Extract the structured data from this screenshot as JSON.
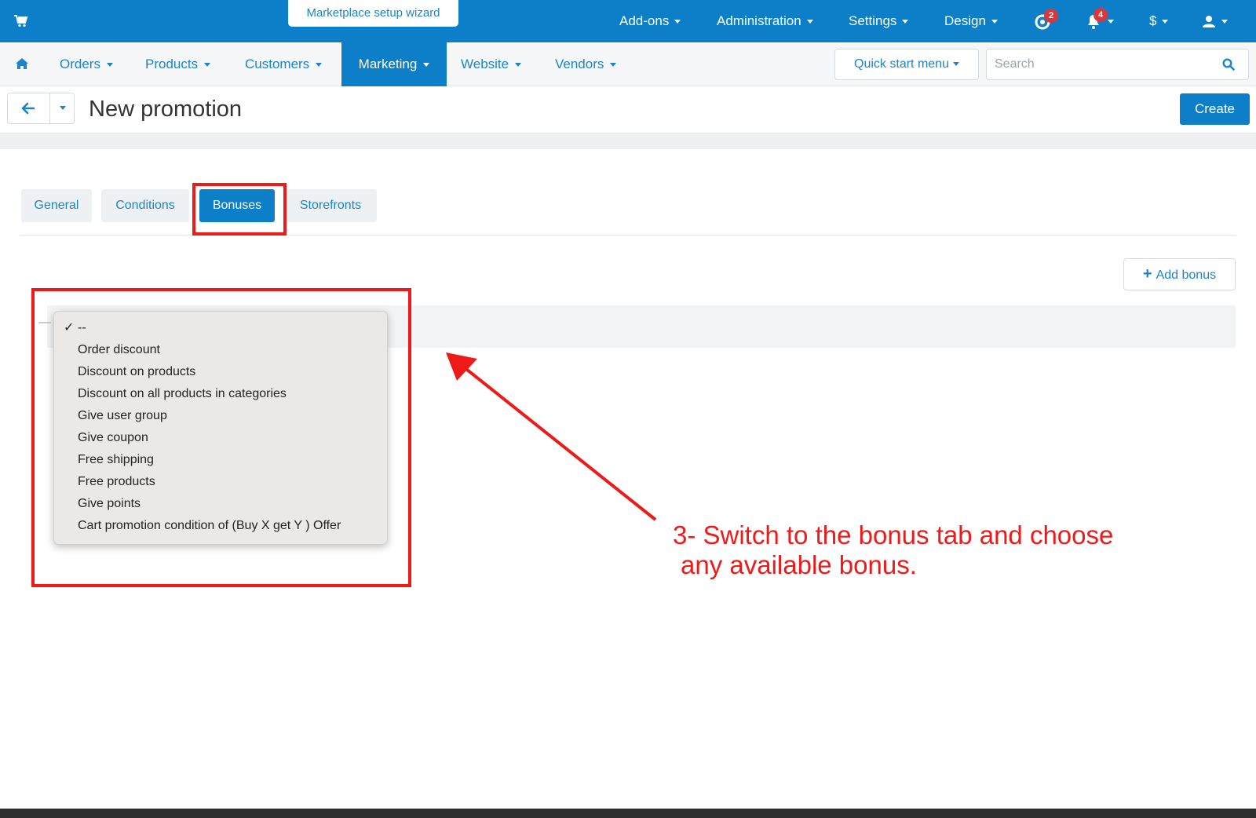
{
  "topbar": {
    "wizard_label": "Marketplace setup wizard",
    "menus": [
      {
        "label": "Add-ons"
      },
      {
        "label": "Administration"
      },
      {
        "label": "Settings"
      },
      {
        "label": "Design"
      }
    ],
    "help_badge": "2",
    "notifications_badge": "4",
    "currency_label": "$",
    "cart_icon": "shopping-cart-icon",
    "user_icon": "user-icon",
    "bg_color": "#0c7fc8"
  },
  "subnav": {
    "home_icon": "home-icon",
    "items": [
      {
        "label": "Orders"
      },
      {
        "label": "Products"
      },
      {
        "label": "Customers"
      },
      {
        "label": "Marketing"
      },
      {
        "label": "Website"
      },
      {
        "label": "Vendors"
      }
    ],
    "active_item": "Marketing",
    "quick_start_label": "Quick start menu",
    "search_placeholder": "Search",
    "search_value": ""
  },
  "titlebar": {
    "title": "New promotion",
    "create_label": "Create"
  },
  "tabs": [
    {
      "label": "General"
    },
    {
      "label": "Conditions"
    },
    {
      "label": "Bonuses"
    },
    {
      "label": "Storefronts"
    }
  ],
  "active_tab": "Bonuses",
  "bonuses": {
    "add_label": "Add bonus"
  },
  "dropdown": {
    "selected": "--",
    "options": [
      {
        "label": "--"
      },
      {
        "label": "Order discount"
      },
      {
        "label": "Discount on products"
      },
      {
        "label": "Discount on all products in categories"
      },
      {
        "label": "Give user group"
      },
      {
        "label": "Give coupon"
      },
      {
        "label": "Free shipping"
      },
      {
        "label": "Free products"
      },
      {
        "label": "Give points"
      },
      {
        "label": "Cart promotion condition of (Buy X get Y ) Offer"
      }
    ]
  },
  "annotation": {
    "line1": "3- Switch to the bonus tab and choose",
    "line2": "any available bonus.",
    "color": "#ee1a1a"
  }
}
